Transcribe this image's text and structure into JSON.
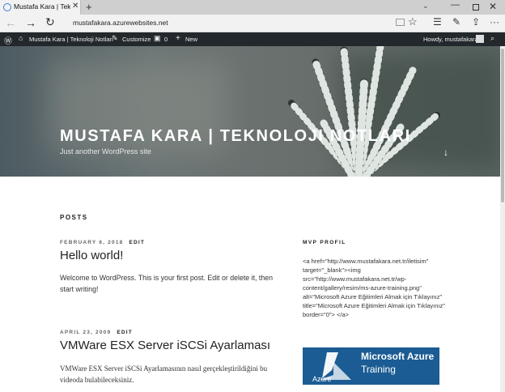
{
  "browser": {
    "tab_title": "Mustafa Kara | Teknoloji",
    "url": "mustafakara.azurewebsites.net"
  },
  "adminbar": {
    "site_name": "Mustafa Kara | Teknoloji Notları",
    "customize": "Customize",
    "comment_count": "0",
    "new_label": "New",
    "howdy": "Howdy, mustafakara"
  },
  "header": {
    "site_title": "MUSTAFA KARA | TEKNOLOJI NOTLARI",
    "tagline": "Just another WordPress site"
  },
  "main": {
    "posts_heading": "POSTS",
    "posts": [
      {
        "date": "FEBRUARY 6, 2018",
        "edit": "EDIT",
        "title": "Hello world!",
        "excerpt": "Welcome to WordPress. This is your first post. Edit or delete it, then start writing!"
      },
      {
        "date": "APRIL 23, 2009",
        "edit": "EDIT",
        "title": "VMWare ESX Server iSCSi Ayarlaması",
        "excerpt": "VMWare ESX Server iSCSi Ayarlamasının nasıl gerçekleştirildiğini bu videoda bulabileceksiniz."
      }
    ]
  },
  "sidebar": {
    "widget_title": "MVP PROFIL",
    "widget_code": "<a href=\"http://www.mustafakara.net.tr/iletisim\" target=\"_blank\"><img src=\"http://www.mustafakara.net.tr/wp-content/gallery/resim/ms-azure-training.png\" alt=\"Microsoft Azure Eğitimleri Almak için Tıklayınız\" title=\"Microsoft Azure Eğitimleri Almak için Tıklayınız\" border=\"0\"> </a>",
    "banner_line1": "Microsoft Azure",
    "banner_line2": "Training",
    "banner_logo": "Azure"
  }
}
